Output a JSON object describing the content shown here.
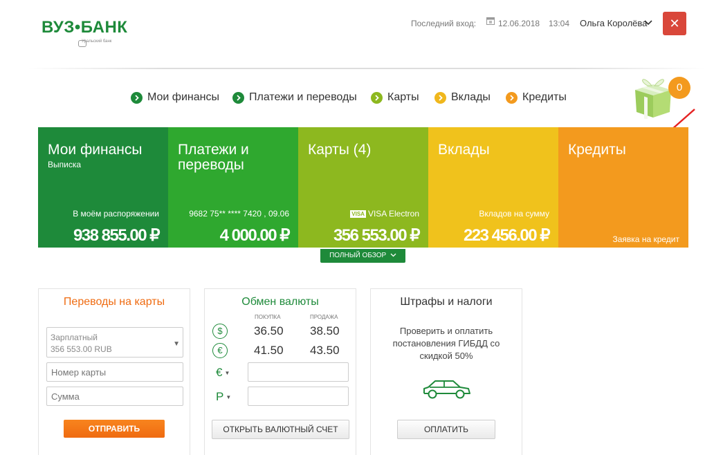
{
  "header": {
    "logo_text": "ВУЗ•БАНК",
    "logo_sub": "Уральский банк",
    "last_login_label": "Последний вход:",
    "last_login_date": "12.06.2018",
    "last_login_time": "13:04",
    "user_name": "Ольга Королёва",
    "close_icon": "✕"
  },
  "nav": {
    "items": [
      {
        "label": "Мои финансы",
        "color": "#1e8a3a"
      },
      {
        "label": "Платежи и переводы",
        "color": "#1e8a3a"
      },
      {
        "label": "Карты",
        "color": "#8db81f"
      },
      {
        "label": "Вклады",
        "color": "#f0b71c"
      },
      {
        "label": "Кредиты",
        "color": "#f39a1e"
      }
    ],
    "gift_count": "0"
  },
  "tiles": [
    {
      "title": "Мои финансы",
      "subtitle": "Выписка",
      "small": "В моём распоряжении",
      "amount": "938 855.00 ₽",
      "color": "#1e8a3a"
    },
    {
      "title": "Платежи и переводы",
      "subtitle": "",
      "small": "9682 75** **** 7420 , 09.06",
      "amount": "4 000.00 ₽",
      "color": "#2fa82f"
    },
    {
      "title": "Карты (4)",
      "subtitle": "",
      "small": "VISA Electron",
      "visa_logo": "VISA",
      "amount": "356 553.00 ₽",
      "color": "#8db81f"
    },
    {
      "title": "Вклады",
      "subtitle": "",
      "small": "Вкладов на сумму",
      "amount": "223 456.00 ₽",
      "color": "#f0c21c"
    },
    {
      "title": "Кредиты",
      "subtitle": "",
      "small": "Заявка на кредит",
      "amount": "",
      "color": "#f39a1e"
    }
  ],
  "overview_button": "ПОЛНЫЙ ОБЗОР",
  "transfer": {
    "title": "Переводы на карты",
    "account_name": "Зарплатный",
    "account_balance": "356 553.00 RUB",
    "card_placeholder": "Номер карты",
    "sum_placeholder": "Сумма",
    "submit": "ОТПРАВИТЬ"
  },
  "exchange": {
    "title": "Обмен валюты",
    "buy_label": "ПОКУПКА",
    "sell_label": "ПРОДАЖА",
    "rates": [
      {
        "symbol": "$",
        "buy": "36.50",
        "sell": "38.50"
      },
      {
        "symbol": "€",
        "buy": "41.50",
        "sell": "43.50"
      }
    ],
    "from_currency": "€",
    "to_currency": "Р",
    "open_account": "ОТКРЫТЬ ВАЛЮТНЫЙ СЧЕТ"
  },
  "fines": {
    "title": "Штрафы и налоги",
    "description": "Проверить и оплатить постановления ГИБДД со скидкой 50%",
    "pay": "ОПЛАТИТЬ"
  }
}
